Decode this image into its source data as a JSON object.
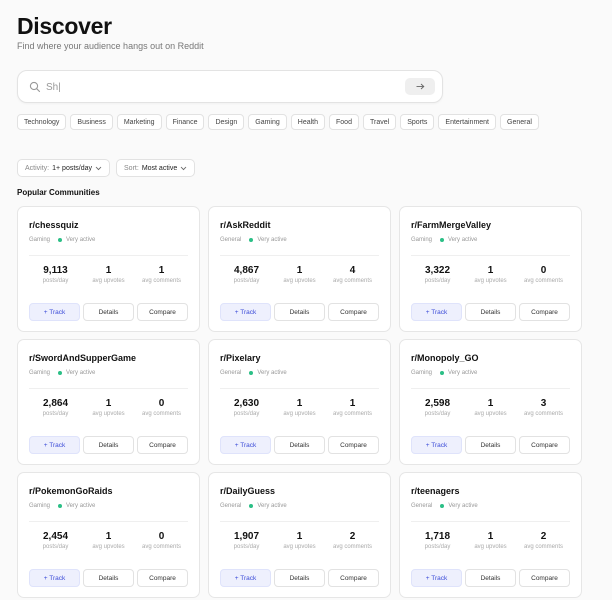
{
  "page": {
    "title": "Discover",
    "subtitle": "Find where your audience hangs out on Reddit"
  },
  "search": {
    "value": "Sh|"
  },
  "categories": [
    "Technology",
    "Business",
    "Marketing",
    "Finance",
    "Design",
    "Gaming",
    "Health",
    "Food",
    "Travel",
    "Sports",
    "Entertainment",
    "General"
  ],
  "filters": {
    "activity": {
      "label": "Activity:",
      "value": "1+ posts/day"
    },
    "sort": {
      "label": "Sort:",
      "value": "Most active"
    }
  },
  "section_title": "Popular Communities",
  "labels": {
    "posts": "posts/day",
    "upvotes": "avg upvotes",
    "comments": "avg comments",
    "track": "+ Track",
    "details": "Details",
    "compare": "Compare"
  },
  "communities": [
    {
      "name": "r/chessquiz",
      "category": "Gaming",
      "activity": "Very active",
      "posts": "9,113",
      "upvotes": "1",
      "comments": "1"
    },
    {
      "name": "r/AskReddit",
      "category": "General",
      "activity": "Very active",
      "posts": "4,867",
      "upvotes": "1",
      "comments": "4"
    },
    {
      "name": "r/FarmMergeValley",
      "category": "Gaming",
      "activity": "Very active",
      "posts": "3,322",
      "upvotes": "1",
      "comments": "0"
    },
    {
      "name": "r/SwordAndSupperGame",
      "category": "Gaming",
      "activity": "Very active",
      "posts": "2,864",
      "upvotes": "1",
      "comments": "0"
    },
    {
      "name": "r/Pixelary",
      "category": "General",
      "activity": "Very active",
      "posts": "2,630",
      "upvotes": "1",
      "comments": "1"
    },
    {
      "name": "r/Monopoly_GO",
      "category": "Gaming",
      "activity": "Very active",
      "posts": "2,598",
      "upvotes": "1",
      "comments": "3"
    },
    {
      "name": "r/PokemonGoRaids",
      "category": "Gaming",
      "activity": "Very active",
      "posts": "2,454",
      "upvotes": "1",
      "comments": "0"
    },
    {
      "name": "r/DailyGuess",
      "category": "General",
      "activity": "Very active",
      "posts": "1,907",
      "upvotes": "1",
      "comments": "2"
    },
    {
      "name": "r/teenagers",
      "category": "General",
      "activity": "Very active",
      "posts": "1,718",
      "upvotes": "1",
      "comments": "2"
    }
  ]
}
